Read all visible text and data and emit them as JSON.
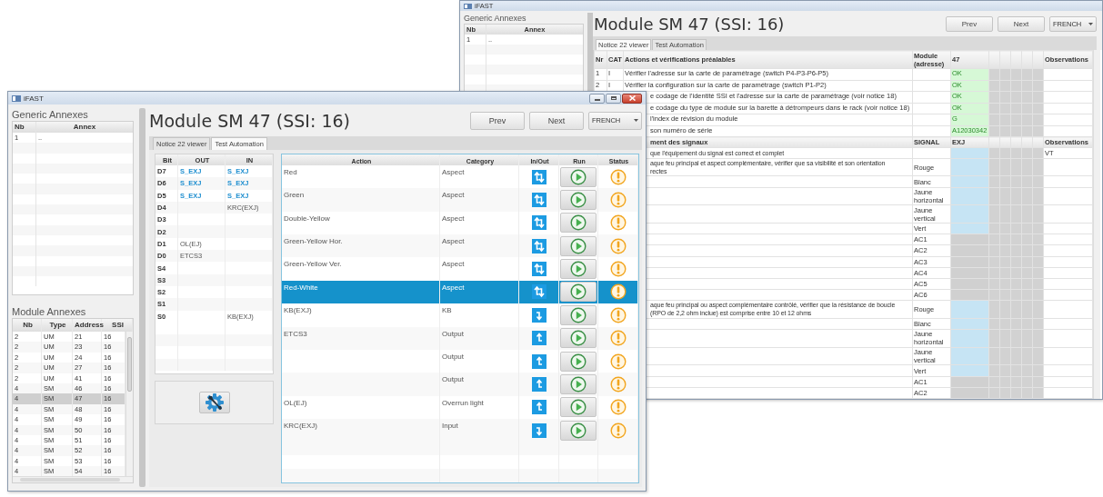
{
  "back_window": {
    "title": "iFAST",
    "generic_annexes": {
      "title": "Generic Annexes",
      "columns": [
        "Nb",
        "Annex"
      ],
      "rows": [
        {
          "nb": "1",
          "annex": ".."
        }
      ]
    },
    "heading": "Module SM 47 (SSI: 16)",
    "buttons": [
      "Prev",
      "Next"
    ],
    "language": "FRENCH",
    "tabs": [
      {
        "label": "Notice 22 viewer",
        "selected": true
      },
      {
        "label": "Test Automation",
        "selected": false
      }
    ],
    "checks": {
      "columns": [
        "Nr",
        "CAT",
        "Actions et vérifications préalables",
        "Module (adresse)",
        "47",
        "Observations"
      ],
      "rows": [
        {
          "nr": "1",
          "cat": "I",
          "action": "Vérifier l'adresse sur la carte de paramétrage (switch P4-P3-P6-P5)",
          "value": "OK"
        },
        {
          "nr": "2",
          "cat": "I",
          "action": "Vérifier la configuration sur la carte de paramétrage (switch P1-P2)",
          "value": "OK"
        },
        {
          "action": "e codage de l'identité SSI et l'adresse sur la carte de paramétrage (voir notice 18)",
          "value": "OK"
        },
        {
          "action": "e codage du type de module sur la barette à détrompeurs dans le rack (voir notice 18)",
          "value": "OK"
        },
        {
          "action": "l'index de révision du module",
          "value": "G"
        },
        {
          "action": "son numéro de série",
          "value": "A12030342"
        }
      ]
    },
    "signals": {
      "columns": [
        "ment des signaux",
        "SIGNAL",
        "EXJ",
        "Observations"
      ],
      "rows": [
        {
          "action": [
            "que l'équipement du signal est correct et complet"
          ],
          "color": "#c6e4f4",
          "observations": "VT"
        },
        {
          "action": [
            "aque feu principal et aspect complémentaire, vérifier que sa visibilité et son orientation",
            "rectes"
          ],
          "signal": "Rouge",
          "color": "#c6e4f4"
        },
        {
          "signal": "Blanc",
          "color": "#c6e4f4"
        },
        {
          "signal": "Jaune horizontal",
          "color": "#c6e4f4"
        },
        {
          "signal": "Jaune vertical",
          "color": "#c6e4f4"
        },
        {
          "signal": "Vert",
          "color": "#c6e4f4"
        },
        {
          "signal": "AC1",
          "color": "#d0d0d0"
        },
        {
          "signal": "AC2",
          "color": "#d0d0d0"
        },
        {
          "signal": "AC3",
          "color": "#d0d0d0"
        },
        {
          "signal": "AC4",
          "color": "#d0d0d0"
        },
        {
          "signal": "AC5",
          "color": "#d0d0d0"
        },
        {
          "signal": "AC6",
          "color": "#d0d0d0"
        },
        {
          "action": [
            "aque feu principal ou aspect complémentaire contrôlé, vérifier que la résistance de boucle",
            "(RPO de 2,2 ohm inclue) est comprise entre 10 et 12 ohms"
          ],
          "signal": "Rouge",
          "color": "#c6e4f4"
        },
        {
          "signal": "Blanc",
          "color": "#c6e4f4"
        },
        {
          "signal": "Jaune horizontal",
          "color": "#c6e4f4"
        },
        {
          "signal": "Jaune vertical",
          "color": "#c6e4f4"
        },
        {
          "signal": "Vert",
          "color": "#c6e4f4"
        },
        {
          "signal": "AC1",
          "color": "#d0d0d0"
        },
        {
          "signal": "AC2",
          "color": "#d0d0d0"
        }
      ]
    }
  },
  "front_window": {
    "title": "iFAST",
    "generic_annexes": {
      "title": "Generic Annexes",
      "columns": [
        "Nb",
        "Annex"
      ],
      "rows": [
        {
          "nb": "1",
          "annex": ".."
        }
      ]
    },
    "module_annexes": {
      "title": "Module Annexes",
      "columns": [
        "Nb",
        "Type",
        "Address",
        "SSI"
      ],
      "rows": [
        {
          "nb": "2",
          "type": "UM",
          "address": "21",
          "ssi": "16",
          "selected": false
        },
        {
          "nb": "2",
          "type": "UM",
          "address": "23",
          "ssi": "16",
          "selected": false
        },
        {
          "nb": "2",
          "type": "UM",
          "address": "24",
          "ssi": "16",
          "selected": false
        },
        {
          "nb": "2",
          "type": "UM",
          "address": "27",
          "ssi": "16",
          "selected": false
        },
        {
          "nb": "2",
          "type": "UM",
          "address": "41",
          "ssi": "16",
          "selected": false
        },
        {
          "nb": "4",
          "type": "SM",
          "address": "46",
          "ssi": "16",
          "selected": false
        },
        {
          "nb": "4",
          "type": "SM",
          "address": "47",
          "ssi": "16",
          "selected": true
        },
        {
          "nb": "4",
          "type": "SM",
          "address": "48",
          "ssi": "16",
          "selected": false
        },
        {
          "nb": "4",
          "type": "SM",
          "address": "49",
          "ssi": "16",
          "selected": false
        },
        {
          "nb": "4",
          "type": "SM",
          "address": "50",
          "ssi": "16",
          "selected": false
        },
        {
          "nb": "4",
          "type": "SM",
          "address": "51",
          "ssi": "16",
          "selected": false
        },
        {
          "nb": "4",
          "type": "SM",
          "address": "52",
          "ssi": "16",
          "selected": false
        },
        {
          "nb": "4",
          "type": "SM",
          "address": "53",
          "ssi": "16",
          "selected": false
        },
        {
          "nb": "4",
          "type": "SM",
          "address": "54",
          "ssi": "16",
          "selected": false
        }
      ]
    },
    "heading": "Module SM 47 (SSI: 16)",
    "buttons": [
      "Prev",
      "Next"
    ],
    "language": "FRENCH",
    "tabs": [
      {
        "label": "Notice 22 viewer",
        "selected": false
      },
      {
        "label": "Test Automation",
        "selected": true
      }
    ],
    "bits": {
      "columns": [
        "Bit",
        "OUT",
        "IN"
      ],
      "rows": [
        {
          "bit": "D7",
          "out": {
            "text": "S_EXJ",
            "kind": "signal"
          },
          "in": {
            "text": "S_EXJ",
            "kind": "signal"
          }
        },
        {
          "bit": "D6",
          "out": {
            "text": "S_EXJ",
            "kind": "signal"
          },
          "in": {
            "text": "S_EXJ",
            "kind": "signal"
          }
        },
        {
          "bit": "D5",
          "out": {
            "text": "S_EXJ",
            "kind": "signal"
          },
          "in": {
            "text": "S_EXJ",
            "kind": "signal"
          }
        },
        {
          "bit": "D4",
          "in": {
            "text": "KRC(EXJ)",
            "kind": "plain"
          }
        },
        {
          "bit": "D3"
        },
        {
          "bit": "D2"
        },
        {
          "bit": "D1",
          "out": {
            "text": "OL(EJ)",
            "kind": "plain"
          }
        },
        {
          "bit": "D0",
          "out": {
            "text": "ETCS3",
            "kind": "plain"
          }
        },
        {
          "bit": "S4"
        },
        {
          "bit": "S3"
        },
        {
          "bit": "S2"
        },
        {
          "bit": "S1"
        },
        {
          "bit": "S0",
          "in": {
            "text": "KB(EXJ)",
            "kind": "plain"
          }
        }
      ]
    },
    "actions": {
      "columns": [
        "Action",
        "Category",
        "In/Out",
        "Run",
        "Status"
      ],
      "rows": [
        {
          "action": "Red",
          "category": "Aspect",
          "kind": "both",
          "selected": false
        },
        {
          "action": "Green",
          "category": "Aspect",
          "kind": "both",
          "selected": false
        },
        {
          "action": "Double-Yellow",
          "category": "Aspect",
          "kind": "both",
          "selected": false
        },
        {
          "action": "Green-Yellow Hor.",
          "category": "Aspect",
          "kind": "both",
          "selected": false
        },
        {
          "action": "Green-Yellow Ver.",
          "category": "Aspect",
          "kind": "both",
          "selected": false
        },
        {
          "action": "Red-White",
          "category": "Aspect",
          "kind": "both",
          "selected": true
        },
        {
          "action": "KB(EXJ)",
          "category": "KB",
          "kind": "in",
          "selected": false
        },
        {
          "action": "ETCS3",
          "category": "Output",
          "kind": "out",
          "selected": false
        },
        {
          "category": "Output",
          "kind": "out",
          "selected": false
        },
        {
          "category": "Output",
          "kind": "out",
          "selected": false
        },
        {
          "action": "OL(EJ)",
          "category": "Overrun light",
          "kind": "out",
          "selected": false
        },
        {
          "action": "KRC(EXJ)",
          "category": "Input",
          "kind": "in",
          "selected": false
        }
      ]
    }
  }
}
